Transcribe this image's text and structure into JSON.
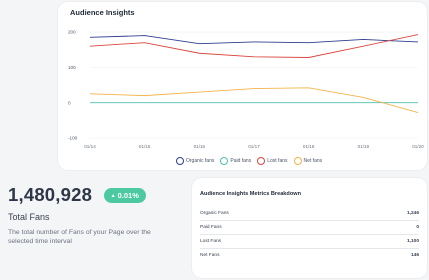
{
  "insights": {
    "title": "Audience Insights"
  },
  "chart_data": {
    "type": "line",
    "x": [
      "01/14",
      "01/15",
      "01/16",
      "01/17",
      "01/18",
      "01/19",
      "01/20"
    ],
    "ylim": [
      -100,
      220
    ],
    "yticks": [
      -100,
      0,
      100,
      200
    ],
    "series": [
      {
        "name": "Organic fans",
        "color": "#2f3e8f",
        "values": [
          185,
          190,
          167,
          172,
          170,
          179,
          172
        ]
      },
      {
        "name": "Paid fans",
        "color": "#4fbfb0",
        "values": [
          0,
          0,
          0,
          0,
          0,
          0,
          0
        ]
      },
      {
        "name": "Lost fans",
        "color": "#d9473f",
        "values": [
          160,
          170,
          140,
          130,
          128,
          160,
          193
        ]
      },
      {
        "name": "Net fans",
        "color": "#f3b44a",
        "values": [
          25,
          20,
          30,
          40,
          42,
          15,
          -28
        ]
      }
    ],
    "legend_position": "bottom",
    "grid": true
  },
  "total": {
    "value": "1,480,928",
    "change": "0.01%",
    "change_arrow": "▲",
    "label": "Total Fans",
    "description": "The total number of Fans of your Page over the selected time interval"
  },
  "breakdown": {
    "title": "Audience Insights Metrics Breakdown",
    "rows": [
      {
        "label": "Organic Fans",
        "value": "1,246"
      },
      {
        "label": "Paid Fans",
        "value": "0"
      },
      {
        "label": "Lost Fans",
        "value": "1,100"
      },
      {
        "label": "Net Fans",
        "value": "146"
      }
    ]
  }
}
